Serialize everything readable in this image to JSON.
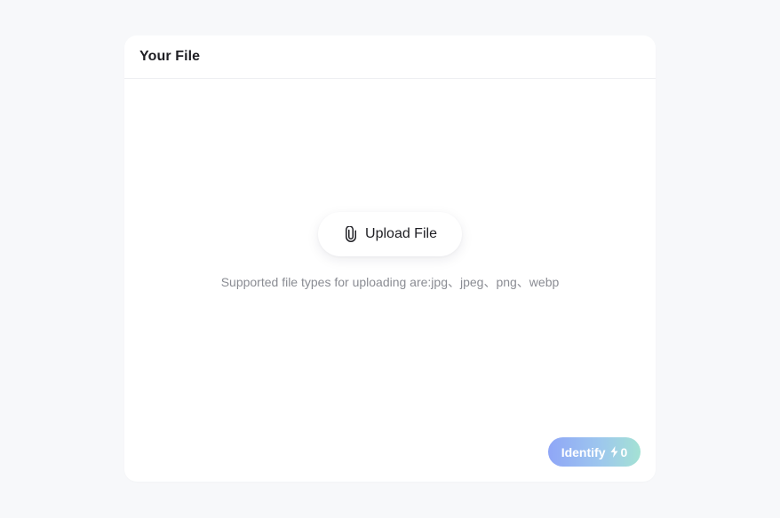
{
  "card": {
    "title": "Your File"
  },
  "upload": {
    "label": "Upload File",
    "icon": "paperclip-icon",
    "supported_text": "Supported file types for uploading are:jpg、jpeg、png、webp"
  },
  "identify": {
    "label": "Identify",
    "icon": "lightning-bolt-icon",
    "credits": "0"
  },
  "colors": {
    "page_background": "#f7f8fa",
    "card_background": "#ffffff",
    "title_text": "#1f1f24",
    "muted_text": "#8a8c93",
    "identify_gradient_start": "#8fa6f7",
    "identify_gradient_end": "#a4e2d4"
  }
}
